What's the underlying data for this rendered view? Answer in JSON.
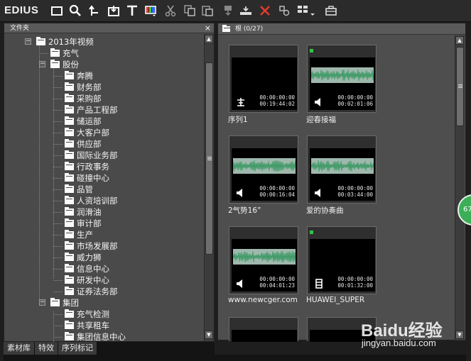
{
  "app": {
    "brand": "EDIUS"
  },
  "toolbar": {
    "icons": [
      "folder-icon",
      "search-icon",
      "up-folder-icon",
      "import-icon",
      "title-icon",
      "color-bar-icon",
      "cut-icon",
      "copy-icon",
      "paste-icon",
      "mark-in-icon",
      "timeline-insert-icon",
      "delete-icon",
      "properties-icon",
      "view-mode-icon",
      "bin-icon"
    ],
    "accent": "#e23a2a"
  },
  "bin_panel": {
    "title": "文件夹",
    "close": "×",
    "tree": [
      {
        "label": "2013年视频",
        "level": 0,
        "expander": "−"
      },
      {
        "label": "充气",
        "level": 1
      },
      {
        "label": "股份",
        "level": 1,
        "expander": "−"
      },
      {
        "label": "奔腾",
        "level": 2
      },
      {
        "label": "财务部",
        "level": 2
      },
      {
        "label": "采购部",
        "level": 2
      },
      {
        "label": "产品工程部",
        "level": 2
      },
      {
        "label": "储运部",
        "level": 2
      },
      {
        "label": "大客户部",
        "level": 2
      },
      {
        "label": "供应部",
        "level": 2
      },
      {
        "label": "国际业务部",
        "level": 2
      },
      {
        "label": "行政事务",
        "level": 2
      },
      {
        "label": "碰撞中心",
        "level": 2
      },
      {
        "label": "品管",
        "level": 2
      },
      {
        "label": "人资培训部",
        "level": 2
      },
      {
        "label": "润滑油",
        "level": 2
      },
      {
        "label": "审计部",
        "level": 2
      },
      {
        "label": "生产",
        "level": 2
      },
      {
        "label": "市场发展部",
        "level": 2
      },
      {
        "label": "威力狮",
        "level": 2
      },
      {
        "label": "信息中心",
        "level": 2
      },
      {
        "label": "研发中心",
        "level": 2
      },
      {
        "label": "证券法务部",
        "level": 2
      },
      {
        "label": "集团",
        "level": 1,
        "expander": "−"
      },
      {
        "label": "充气检测",
        "level": 2
      },
      {
        "label": "共享租车",
        "level": 2
      },
      {
        "label": "集团信息中心",
        "level": 2
      }
    ],
    "tabs": [
      "素材库",
      "特效",
      "序列标记"
    ]
  },
  "clip_panel": {
    "title": "根 (0/27)",
    "clips": [
      {
        "name": "序列1",
        "tc_in": "00:00:00:00",
        "tc_dur": "00:19:44:02",
        "kind": "sequence",
        "online": false
      },
      {
        "name": "迎春接福",
        "tc_in": "00:00:00:00",
        "tc_dur": "00:02:01:06",
        "kind": "audio",
        "online": true
      },
      {
        "name": "2气势16”",
        "tc_in": "00:00:00:00",
        "tc_dur": "00:00:16:04",
        "kind": "audio",
        "online": false
      },
      {
        "name": "爱的协奏曲",
        "tc_in": "00:00:00:00",
        "tc_dur": "00:03:44:00",
        "kind": "audio",
        "online": false
      },
      {
        "name": "www.newcger.com",
        "tc_in": "00:00:00:00",
        "tc_dur": "00:04:01:23",
        "kind": "audio",
        "online": false
      },
      {
        "name": "HUAWEI_SUPER",
        "tc_in": "00:00:00:00",
        "tc_dur": "00:01:32:00",
        "kind": "video",
        "online": true
      }
    ],
    "online_color": "#35c34a"
  },
  "overlay": {
    "badge": "67",
    "watermark": "Baidu经验",
    "watermark_url": "jingyan.baidu.com"
  }
}
